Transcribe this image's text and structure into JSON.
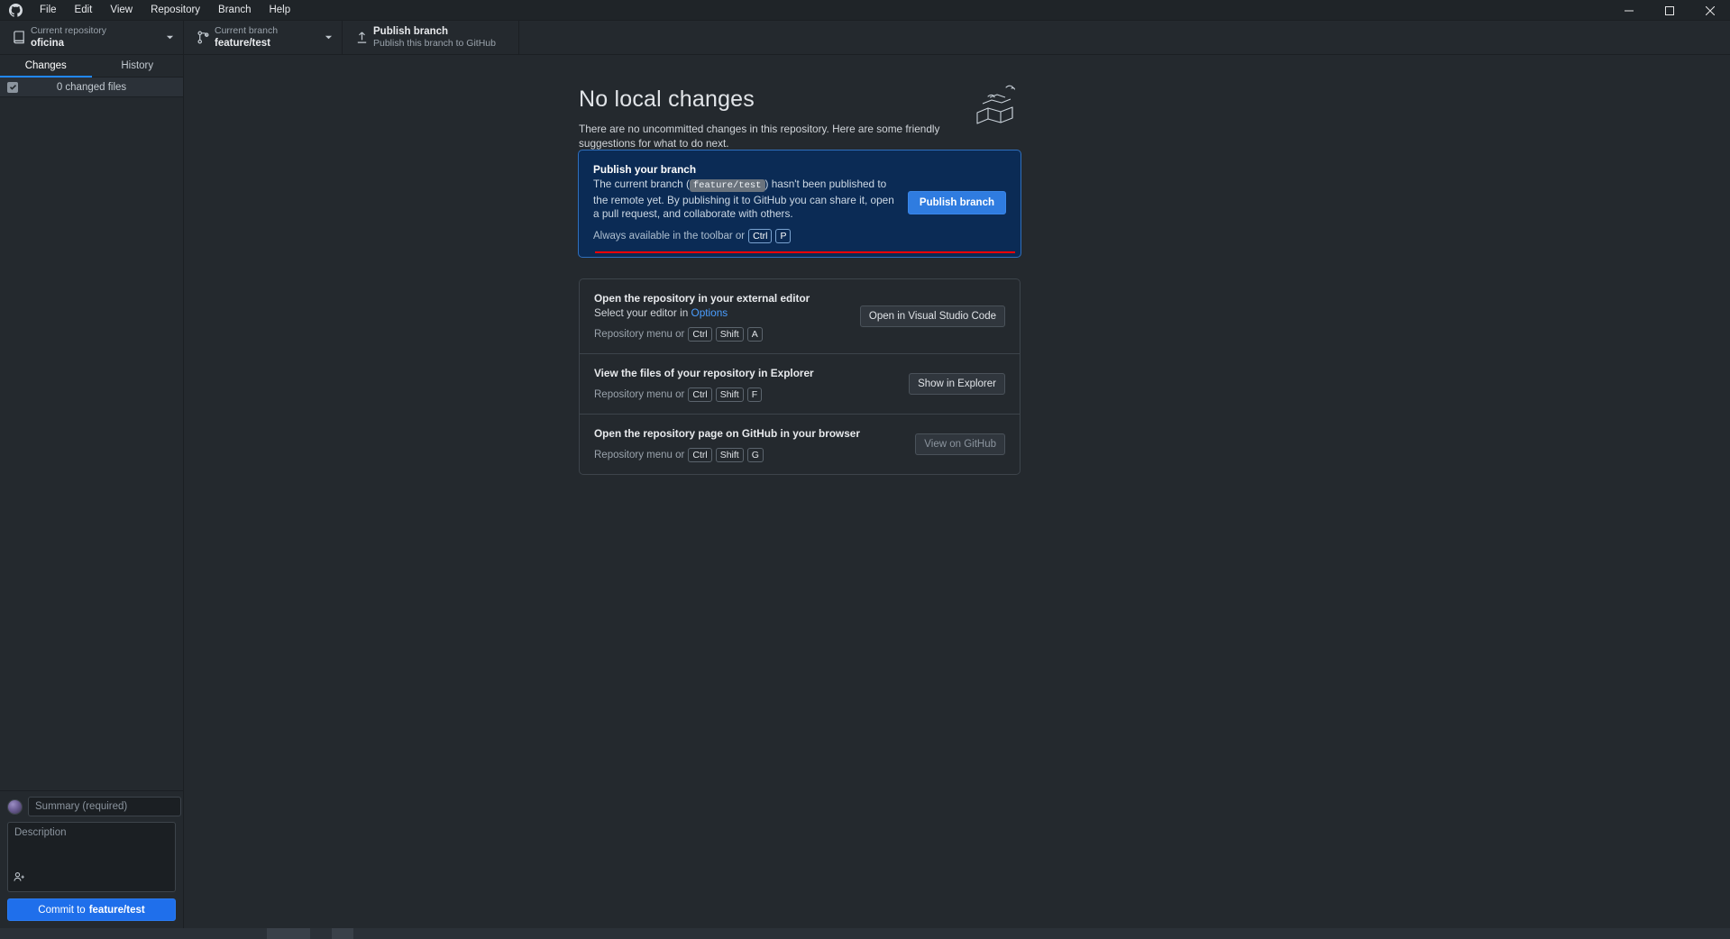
{
  "titlebar": {
    "logo_icon": "github-mark-icon",
    "menu": [
      "File",
      "Edit",
      "View",
      "Repository",
      "Branch",
      "Help"
    ],
    "window_controls": [
      "minimize",
      "maximize",
      "close"
    ]
  },
  "toolbar": {
    "repository": {
      "label": "Current repository",
      "value": "oficina",
      "icon": "repo-icon"
    },
    "branch": {
      "label": "Current branch",
      "value": "feature/test",
      "icon": "branch-icon"
    },
    "publish": {
      "title": "Publish branch",
      "subtitle": "Publish this branch to GitHub",
      "icon": "upload-icon"
    }
  },
  "sidebar": {
    "tabs": [
      {
        "label": "Changes",
        "active": true
      },
      {
        "label": "History",
        "active": false
      }
    ],
    "changed_files_label": "0 changed files",
    "checkbox_checked": true,
    "commit": {
      "summary_placeholder": "Summary (required)",
      "summary_value": "",
      "description_placeholder": "Description",
      "description_value": "",
      "coauthor_icon": "add-person-icon",
      "button_prefix": "Commit to ",
      "button_branch": "feature/test"
    }
  },
  "main": {
    "heading": "No local changes",
    "paragraph": "There are no uncommitted changes in this repository. Here are some friendly suggestions for what to do next.",
    "illustration_icon": "open-boxes-icon",
    "cards": [
      {
        "id": "publish-branch",
        "primary": true,
        "title": "Publish your branch",
        "desc_before": "The current branch (",
        "desc_chip": "feature/test",
        "desc_after": ") hasn't been published to the remote yet. By publishing it to GitHub you can share it, open a pull request, and collaborate with others.",
        "foot_text": "Always available in the toolbar or",
        "keys": [
          "Ctrl",
          "P"
        ],
        "button": "Publish branch",
        "button_style": "blue",
        "annotated": true
      },
      {
        "id": "external-editor",
        "primary": false,
        "title": "Open the repository in your external editor",
        "desc_before": "Select your editor in ",
        "desc_link": "Options",
        "desc_after": "",
        "foot_text": "Repository menu or",
        "keys": [
          "Ctrl",
          "Shift",
          "A"
        ],
        "button": "Open in Visual Studio Code",
        "button_style": "default"
      },
      {
        "id": "show-in-explorer",
        "primary": false,
        "title": "View the files of your repository in Explorer",
        "desc_before": "",
        "desc_after": "",
        "foot_text": "Repository menu or",
        "keys": [
          "Ctrl",
          "Shift",
          "F"
        ],
        "button": "Show in Explorer",
        "button_style": "default"
      },
      {
        "id": "view-on-github",
        "primary": false,
        "title": "Open the repository page on GitHub in your browser",
        "desc_before": "",
        "desc_after": "",
        "foot_text": "Repository menu or",
        "keys": [
          "Ctrl",
          "Shift",
          "G"
        ],
        "button": "View on GitHub",
        "button_style": "dim"
      }
    ]
  },
  "colors": {
    "accent_blue": "#1f6feb",
    "primary_card_bg": "#0b2b55",
    "primary_card_border": "#2f6fbd",
    "annotation_red": "#ff0000",
    "app_bg": "#24292e"
  }
}
